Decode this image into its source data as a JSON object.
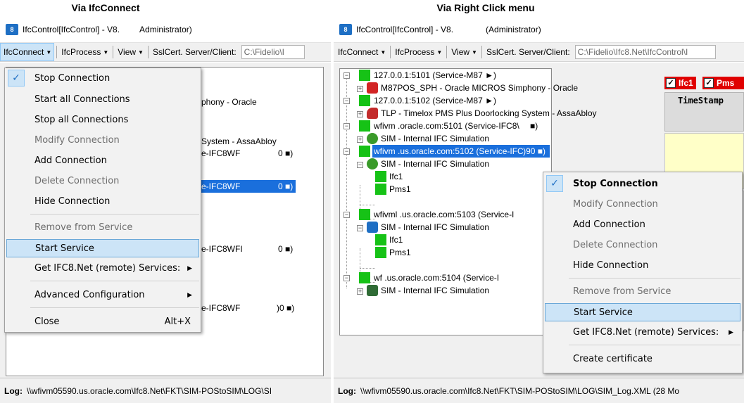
{
  "captions": {
    "left": "Via IfcConnect",
    "right": "Via Right Click menu"
  },
  "left_window": {
    "title": "IfcControl[IfcControl] - V8.",
    "title_suffix": "Administrator)",
    "menu": [
      "IfcConnect",
      "IfcProcess",
      "View"
    ],
    "sslcert_label": "SslCert. Server/Client:",
    "path": "C:\\Fidelio\\I",
    "peek": [
      "phony - Oracle",
      "System - AssaAbloy",
      "e-IFC8WF",
      "0 ■)",
      "e-IFC8WF",
      "0 ■)",
      "e-IFC8WFI",
      "0 ■)",
      "e-IFC8WF",
      ")0 ■)"
    ],
    "log_label": "Log:",
    "log_path": "\\\\wfivm05590.us.oracle.com\\Ifc8.Net\\FKT\\SIM-POStoSIM\\LOG\\SI"
  },
  "left_menu": {
    "check_mark": "✓",
    "items": [
      {
        "label": "Stop Connection",
        "disabled": false
      },
      {
        "label": "Start all Connections",
        "disabled": false
      },
      {
        "label": "Stop all Connections",
        "disabled": false
      },
      {
        "label": "Modify Connection",
        "disabled": true
      },
      {
        "label": "Add Connection",
        "disabled": false
      },
      {
        "label": "Delete Connection",
        "disabled": true
      },
      {
        "label": "Hide Connection",
        "disabled": false
      },
      {
        "label": "Remove from Service",
        "disabled": true
      },
      {
        "label": "Start Service",
        "disabled": false
      },
      {
        "label": "Get IFC8.Net (remote) Services:",
        "disabled": false
      },
      {
        "label": "Advanced Configuration",
        "disabled": false
      },
      {
        "label": "Close",
        "disabled": false,
        "shortcut": "Alt+X"
      }
    ]
  },
  "right_window": {
    "title": "IfcControl[IfcControl] - V8.",
    "title_suffix": "(Administrator)",
    "menu": [
      "IfcConnect",
      "IfcProcess",
      "View"
    ],
    "sslcert_label": "SslCert. Server/Client:",
    "path": "C:\\Fidelio\\Ifc8.Net\\IfcControl\\I",
    "tree": [
      "127.0.0.1:5101 (Service-M87 ►)",
      "M87POS_SPH - Oracle MICROS Simphony - Oracle",
      "127.0.0.1:5102 (Service-M87 ►)",
      "TLP - Timelox PMS Plus Doorlocking System - AssaAbloy",
      "wfivm         .oracle.com:5101 (Service-IFC8\\",
      "SIM - Internal IFC Simulation",
      "wfivm          .us.oracle.com:5102 (Service-IFC",
      "SIM - Internal IFC Simulation",
      "Ifc1",
      "Pms1",
      "wfivml          .us.oracle.com:5103 (Service-I",
      "SIM - Internal IFC Simulation",
      "Ifc1",
      "Pms1",
      "wf              .us.oracle.com:5104 (Service-I",
      "SIM - Internal IFC Simulation"
    ],
    "tree_suffix_1": "■)",
    "tree_suffix_2": ")90 ■)",
    "checkbox_1": "Ifc1",
    "checkbox_2": "Pms",
    "timestamp": "TimeStamp",
    "log_label": "Log:",
    "log_path": "\\\\wfivm05590.us.oracle.com\\Ifc8.Net\\FKT\\SIM-POStoSIM\\LOG\\SIM_Log.XML (28 Mo"
  },
  "right_menu": {
    "check_mark": "✓",
    "items": [
      {
        "label": "Stop Connection",
        "disabled": false
      },
      {
        "label": "Modify Connection",
        "disabled": true
      },
      {
        "label": "Add Connection",
        "disabled": false
      },
      {
        "label": "Delete Connection",
        "disabled": true
      },
      {
        "label": "Hide Connection",
        "disabled": false
      },
      {
        "label": "Remove from Service",
        "disabled": true
      },
      {
        "label": "Start Service",
        "disabled": false
      },
      {
        "label": "Get IFC8.Net (remote) Services:",
        "disabled": false
      },
      {
        "label": "Create certificate",
        "disabled": false
      }
    ]
  }
}
